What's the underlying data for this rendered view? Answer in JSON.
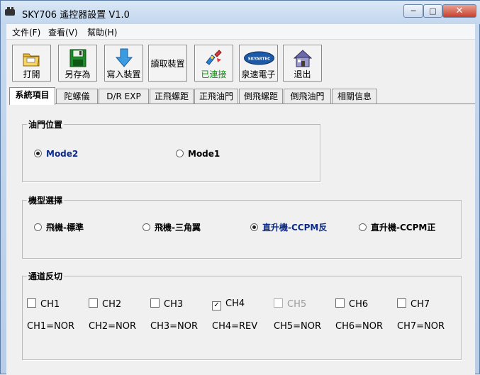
{
  "window": {
    "title": "SKY706 遙控器設置 V1.0",
    "min_glyph": "─",
    "max_glyph": "□",
    "close_glyph": "✕"
  },
  "menu": [
    "文件(F)",
    "查看(V)",
    "幫助(H)"
  ],
  "toolbar": {
    "open": "打開",
    "saveas": "另存為",
    "write": "寫入裝置",
    "read": "讀取裝置",
    "connected": "已連接",
    "brand": "泉速電子",
    "exit": "退出",
    "brand_logo_text": "SKYARTEC"
  },
  "tabs": [
    "系統項目",
    "陀螺儀",
    "D/R EXP",
    "正飛螺距",
    "正飛油門",
    "倒飛螺距",
    "倒飛油門",
    "相關信息"
  ],
  "throttle": {
    "title": "油門位置",
    "options": [
      "Mode2",
      "Mode1"
    ],
    "selected": 0
  },
  "model": {
    "title": "機型選擇",
    "options": [
      "飛機-標準",
      "飛機-三角翼",
      "直升機-CCPM反",
      "直升機-CCPM正"
    ],
    "selected": 2
  },
  "channel": {
    "title": "通道反切",
    "channels": [
      {
        "label": "CH1",
        "checked": false,
        "disabled": false,
        "status": "CH1=NOR"
      },
      {
        "label": "CH2",
        "checked": false,
        "disabled": false,
        "status": "CH2=NOR"
      },
      {
        "label": "CH3",
        "checked": false,
        "disabled": false,
        "status": "CH3=NOR"
      },
      {
        "label": "CH4",
        "checked": true,
        "disabled": false,
        "status": "CH4=REV"
      },
      {
        "label": "CH5",
        "checked": false,
        "disabled": true,
        "status": "CH5=NOR"
      },
      {
        "label": "CH6",
        "checked": false,
        "disabled": false,
        "status": "CH6=NOR"
      },
      {
        "label": "CH7",
        "checked": false,
        "disabled": false,
        "status": "CH7=NOR"
      }
    ]
  },
  "colors": {
    "accent": "#0b2a8a",
    "connected": "#0a8a0a",
    "close_button": "#c8402c"
  }
}
